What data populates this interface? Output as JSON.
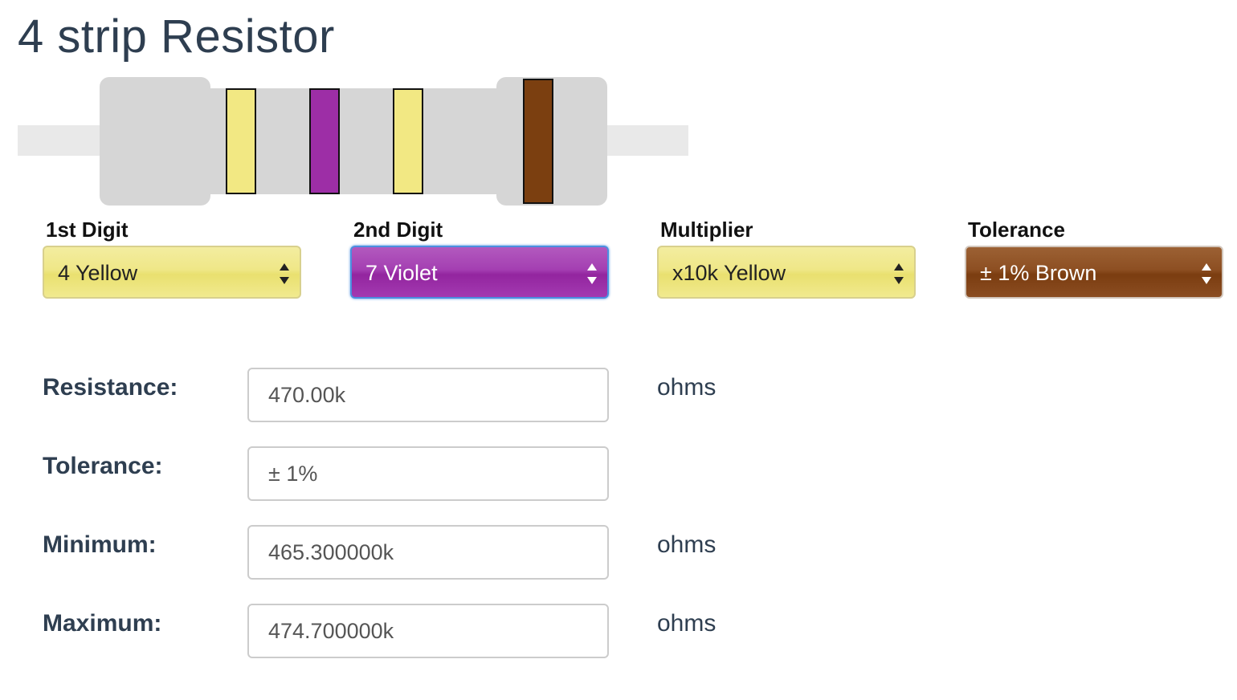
{
  "title": "4 strip Resistor",
  "resistor": {
    "body_color": "#d6d6d6",
    "lead_color": "#e9e9e9",
    "bands": [
      {
        "name": "Yellow",
        "color": "#f2e883"
      },
      {
        "name": "Violet",
        "color": "#9d2ea6"
      },
      {
        "name": "Yellow",
        "color": "#f2e883"
      },
      {
        "name": "Brown",
        "color": "#7b3f10"
      }
    ]
  },
  "selects": [
    {
      "label": "1st Digit",
      "value": "4 Yellow",
      "color": "#efe787"
    },
    {
      "label": "2nd Digit",
      "value": "7 Violet",
      "color": "#a43fb2"
    },
    {
      "label": "Multiplier",
      "value": "x10k Yellow",
      "color": "#efe787"
    },
    {
      "label": "Tolerance",
      "value": "± 1% Brown",
      "color": "#8d4f22"
    }
  ],
  "results": {
    "resistance": {
      "label": "Resistance:",
      "value": "470.00k",
      "unit": "ohms"
    },
    "tolerance": {
      "label": "Tolerance:",
      "value": "± 1%"
    },
    "minimum": {
      "label": "Minimum:",
      "value": "465.300000k",
      "unit": "ohms"
    },
    "maximum": {
      "label": "Maximum:",
      "value": "474.700000k",
      "unit": "ohms"
    }
  }
}
